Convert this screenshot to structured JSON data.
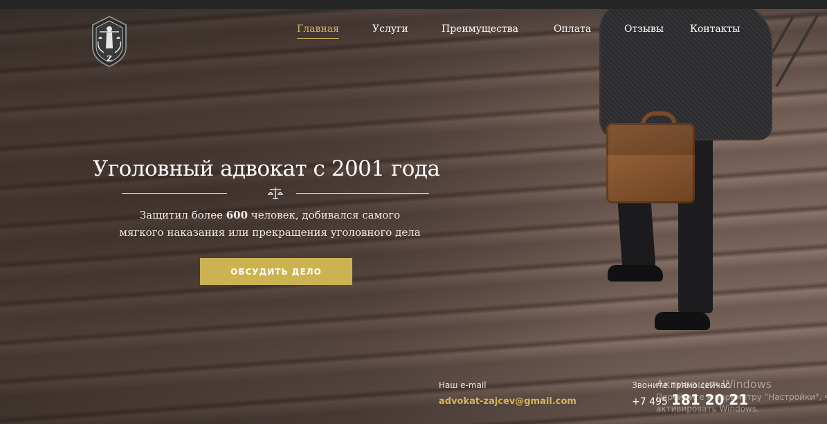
{
  "nav": {
    "items": [
      {
        "label": "Главная",
        "active": true
      },
      {
        "label": "Услуги",
        "active": false
      },
      {
        "label": "Преимущества",
        "active": false
      },
      {
        "label": "Оплата",
        "active": false
      },
      {
        "label": "Отзывы",
        "active": false
      },
      {
        "label": "Контакты",
        "active": false
      }
    ]
  },
  "logo": {
    "letter": "Z"
  },
  "hero": {
    "title": "Уголовный адвокат с 2001 года",
    "subtitle_pre": "Защитил более ",
    "subtitle_bold": "600",
    "subtitle_post": " человек, добивался самого",
    "subtitle_line2": "мягкого наказания или прекращения уголовного дела",
    "cta_label": "ОБСУДИТЬ ДЕЛО"
  },
  "contacts": {
    "email_label": "Наш e-mail",
    "email": "advokat-zajcev@gmail.com",
    "phone_label": "Звоните прямо сейчас",
    "phone_code": "+7 495",
    "phone_number": "181 20 21"
  },
  "watermark": {
    "title": "Активация Windows",
    "line1": "Перейдите к параметру \"Настройки\", ч",
    "line2": "активировать Windows."
  },
  "colors": {
    "accent": "#cdb252",
    "nav_active": "#d3b55a"
  }
}
